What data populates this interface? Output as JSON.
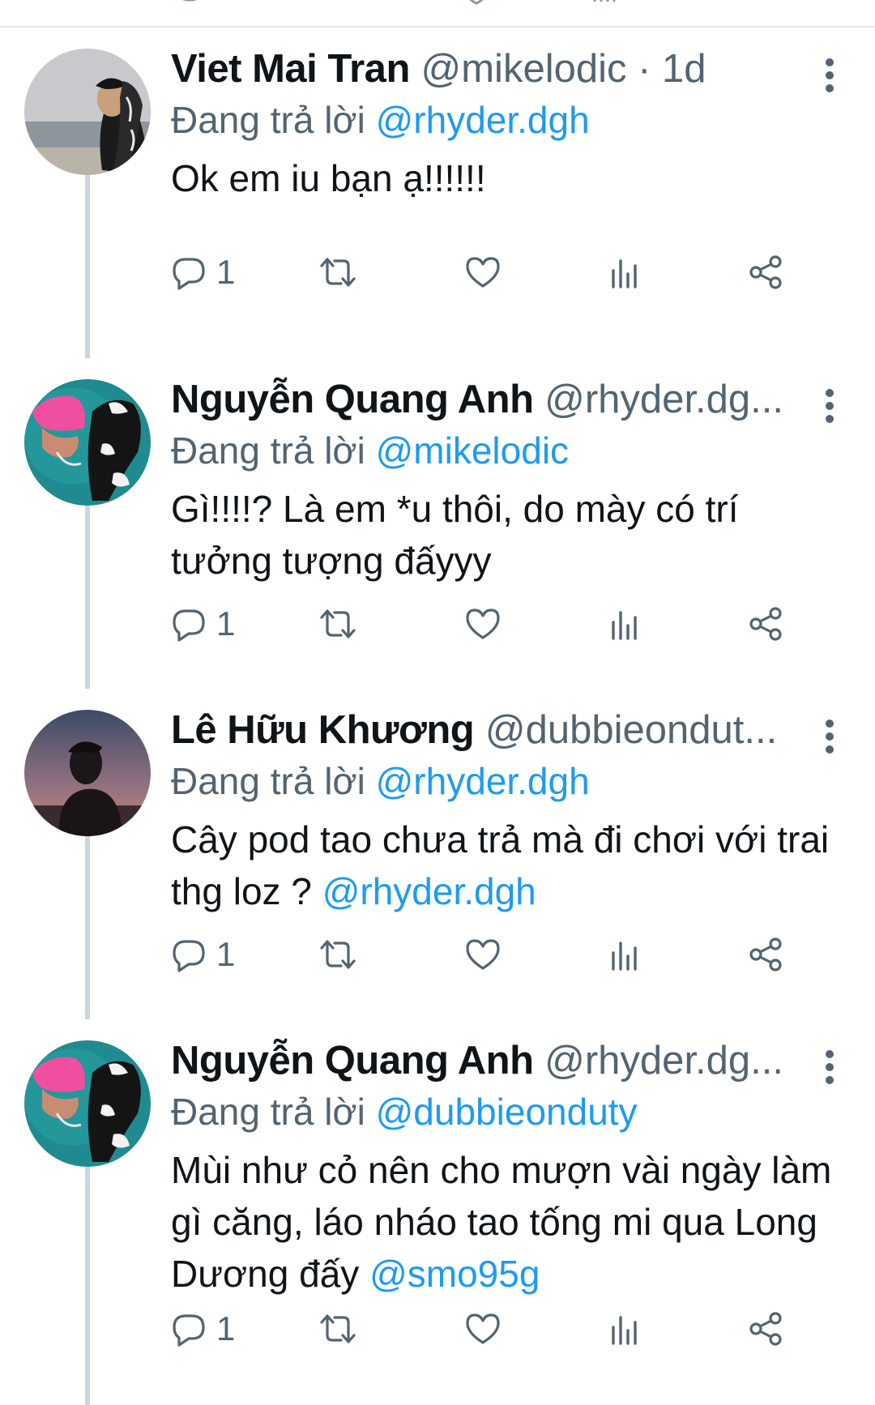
{
  "tweets": [
    {
      "name": "Viet Mai Tran",
      "handle": "@mikelodic",
      "time": " · 1d",
      "reply_prefix": "Đang trả lời ",
      "reply_to": "@rhyder.dgh",
      "text": "Ok em iu bạn ạ!!!!!!",
      "text_mention": "",
      "reply_count": "1",
      "avatar": "avatar-sea-portrait"
    },
    {
      "name": "Nguyễn Quang Anh",
      "handle": "@rhyder.dg...",
      "time": "",
      "reply_prefix": "Đang trả lời ",
      "reply_to": "@mikelodic",
      "text": "Gì!!!!? Là em *u thôi, do mày có trí tưởng tượng đấyyy",
      "text_mention": "",
      "reply_count": "1",
      "avatar": "avatar-pink-hair"
    },
    {
      "name": "Lê Hữu Khương",
      "handle": "@dubbieondut...",
      "time": "",
      "reply_prefix": "Đang trả lời ",
      "reply_to": "@rhyder.dgh",
      "text": "Cây pod tao chưa trả mà đi chơi với trai thg loz ? ",
      "text_mention": "@rhyder.dgh",
      "reply_count": "1",
      "avatar": "avatar-sunset-silhouette"
    },
    {
      "name": "Nguyễn Quang Anh",
      "handle": "@rhyder.dg...",
      "time": "",
      "reply_prefix": "Đang trả lời ",
      "reply_to": "@dubbieonduty",
      "text": "Mùi như cỏ nên cho mượn vài ngày làm gì căng, láo nháo tao tống mi qua Long Dương đấy ",
      "text_mention": "@smo95g",
      "reply_count": "1",
      "avatar": "avatar-pink-hair"
    }
  ],
  "colors": {
    "text": "#0f1419",
    "secondary": "#536471",
    "accent": "#1d9bf0",
    "thread_line": "#ccd6dd"
  },
  "icons": [
    "reply-icon",
    "retweet-icon",
    "like-icon",
    "analytics-icon",
    "share-icon",
    "more-icon"
  ]
}
